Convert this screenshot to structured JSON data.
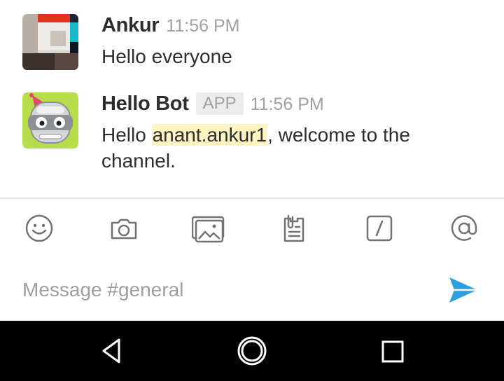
{
  "channel": "general",
  "messages": [
    {
      "author": "Ankur",
      "time": "11:56 PM",
      "text": "Hello everyone"
    },
    {
      "author": "Hello Bot",
      "badge": "APP",
      "time": "11:56 PM",
      "text_before": "Hello ",
      "mention": "anant.ankur1",
      "text_after": ", welcome to the channel."
    }
  ],
  "toolbar": {
    "icons": [
      "emoji-icon",
      "camera-icon",
      "photo-library-icon",
      "file-icon",
      "slash-command-icon",
      "mention-icon"
    ]
  },
  "composer": {
    "placeholder": "Message #general",
    "value": ""
  },
  "colors": {
    "text": "#2c2d30",
    "muted": "#a0a0a2",
    "mention_bg": "#fff4bf",
    "send_blue": "#2d9ee0",
    "icon_gray": "#717274"
  },
  "system_nav": [
    "back-icon",
    "home-icon",
    "recents-icon"
  ]
}
